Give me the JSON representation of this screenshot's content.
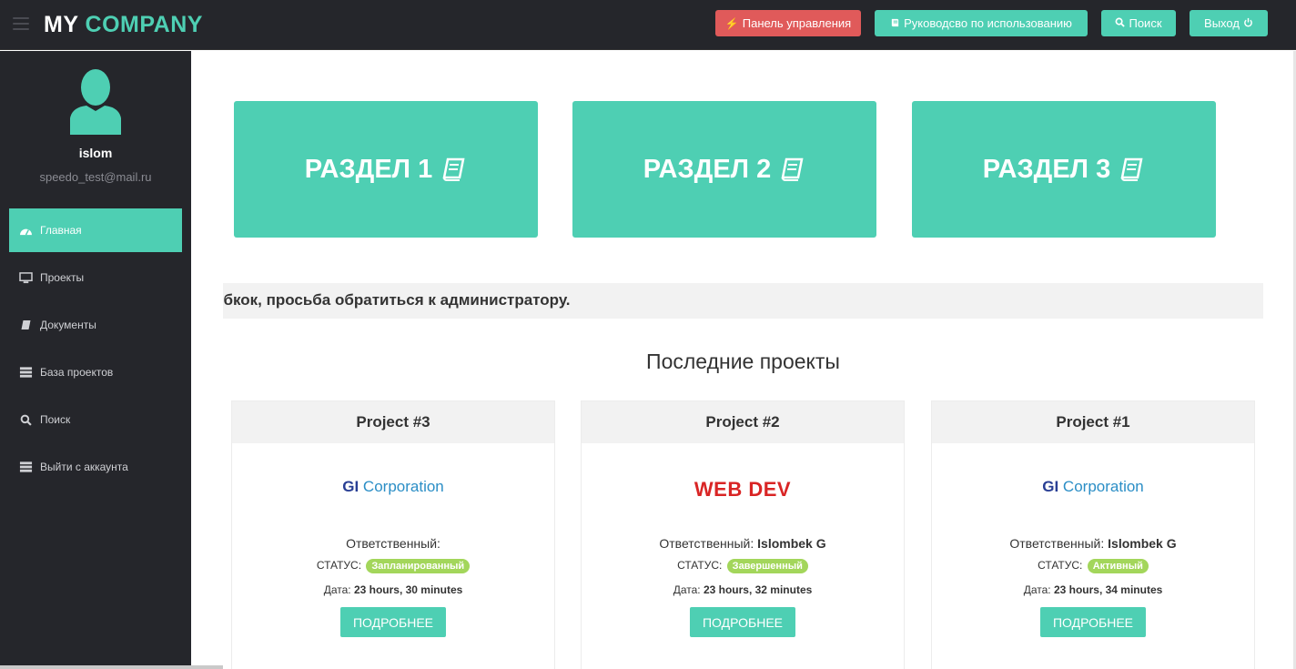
{
  "brand": {
    "part1": "MY",
    "part2": "COMPANY"
  },
  "nav": {
    "control_panel": "Панель управления",
    "manual": "Руководсво по использованию",
    "search": "Поиск",
    "logout": "Выход"
  },
  "user": {
    "name": "islom",
    "email": "speedo_test@mail.ru"
  },
  "sidebar": {
    "items": [
      {
        "label": "Главная",
        "icon": "dashboard-icon"
      },
      {
        "label": "Проекты",
        "icon": "monitor-icon"
      },
      {
        "label": "Документы",
        "icon": "book-icon"
      },
      {
        "label": "База проектов",
        "icon": "server-icon"
      },
      {
        "label": "Поиск",
        "icon": "search-icon"
      },
      {
        "label": "Выйти с аккаунта",
        "icon": "server-icon"
      }
    ]
  },
  "tiles": [
    {
      "label": "РАЗДЕЛ 1"
    },
    {
      "label": "РАЗДЕЛ 2"
    },
    {
      "label": "РАЗДЕЛ 3"
    }
  ],
  "marquee": "ибкок, просьба обратиться к администратору.",
  "projects_title": "Последние проекты",
  "projects": [
    {
      "title": "Project #3",
      "logo": {
        "part1": "GI",
        "part2": "Corporation"
      },
      "resp_label": "Ответственный:",
      "resp_value": "",
      "status_label": "СТАТУС:",
      "status": "Запланированный",
      "date_label": "Дата:",
      "date": "23 hours, 30 minutes",
      "button": "ПОДРОБНЕЕ"
    },
    {
      "title": "Project #2",
      "logo_text": "WEB DEV",
      "resp_label": "Ответственный:",
      "resp_value": "Islombek G",
      "status_label": "СТАТУС:",
      "status": "Завершенный",
      "date_label": "Дата:",
      "date": "23 hours, 32 minutes",
      "button": "ПОДРОБНЕЕ"
    },
    {
      "title": "Project #1",
      "logo": {
        "part1": "GI",
        "part2": "Corporation"
      },
      "resp_label": "Ответственный:",
      "resp_value": "Islombek G",
      "status_label": "СТАТУС:",
      "status": "Активный",
      "date_label": "Дата:",
      "date": "23 hours, 34 minutes",
      "button": "ПОДРОБНЕЕ"
    }
  ],
  "colors": {
    "accent": "#4ecfb3",
    "danger": "#e05a5a",
    "dark": "#25262b",
    "badge": "#a3d65b",
    "webdev": "#d92525"
  }
}
